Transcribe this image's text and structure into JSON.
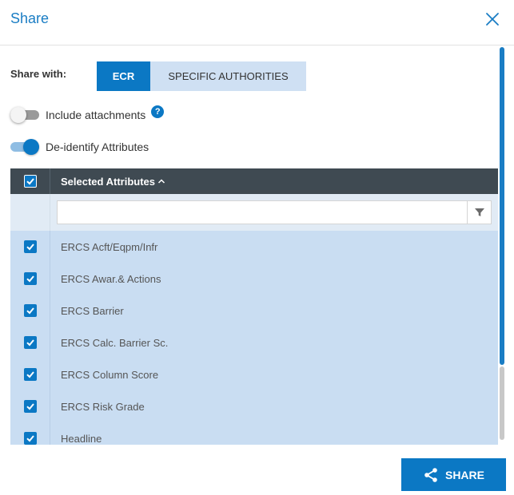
{
  "dialog": {
    "title": "Share"
  },
  "share_with": {
    "label": "Share with:",
    "options": [
      "ECR",
      "SPECIFIC AUTHORITIES"
    ],
    "selected": "ECR"
  },
  "toggles": {
    "include_attachments": {
      "label": "Include attachments",
      "on": false,
      "help": "?"
    },
    "deidentify": {
      "label": "De-identify Attributes",
      "on": true
    }
  },
  "grid": {
    "column_title": "Selected Attributes",
    "filter_placeholder": "",
    "rows": [
      {
        "label": "ERCS Acft/Eqpm/Infr",
        "checked": true
      },
      {
        "label": "ERCS Awar.& Actions",
        "checked": true
      },
      {
        "label": "ERCS Barrier",
        "checked": true
      },
      {
        "label": "ERCS Calc. Barrier Sc.",
        "checked": true
      },
      {
        "label": "ERCS Column Score",
        "checked": true
      },
      {
        "label": "ERCS Risk Grade",
        "checked": true
      },
      {
        "label": "Headline",
        "checked": true
      }
    ]
  },
  "footer": {
    "share_label": "SHARE"
  },
  "colors": {
    "accent": "#0b78c4",
    "header_dark": "#3f4a52",
    "row_selected": "#c9ddf2",
    "segment_inactive": "#cfe0f3"
  },
  "icons": {
    "close": "close-icon",
    "help": "help-icon",
    "sort": "chevron-up-icon",
    "filter": "filter-icon",
    "share": "share-icon",
    "check": "check-icon"
  }
}
